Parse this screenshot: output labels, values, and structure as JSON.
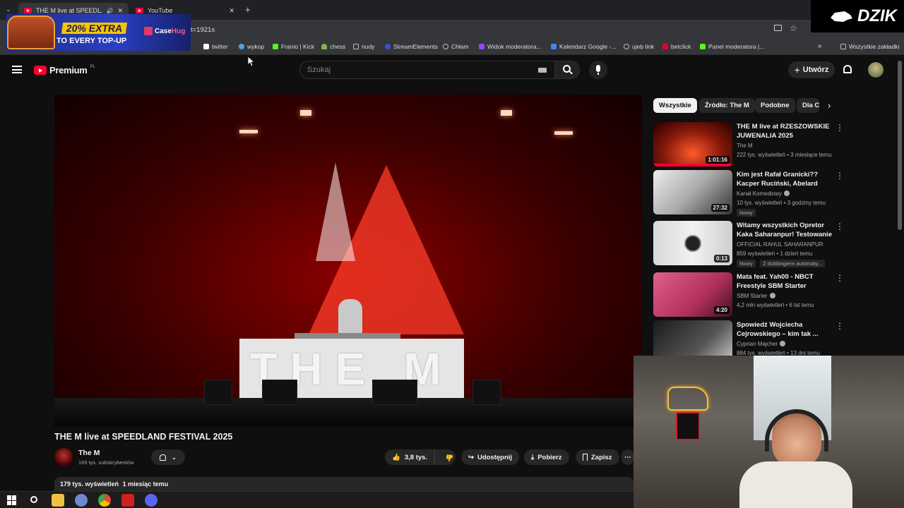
{
  "browser": {
    "tabs": [
      {
        "title": "THE M live at SPEEDLAND F"
      },
      {
        "title": "YouTube"
      }
    ],
    "address": "t=1921s",
    "bookmarks": [
      {
        "label": "twitter",
        "color": "#ffffff"
      },
      {
        "label": "wykop",
        "color": "#5aa0d8"
      },
      {
        "label": "Franio | Kick",
        "color": "#53fc18"
      },
      {
        "label": "chess",
        "color": "#81b64c"
      },
      {
        "label": "nudy",
        "color": "#999999"
      },
      {
        "label": "StreamElements",
        "color": "#3b4fd9"
      },
      {
        "label": "Chłam",
        "color": "#bbbbbb"
      },
      {
        "label": "Widok moderatora...",
        "color": "#9146ff"
      },
      {
        "label": "Kalendarz Google -...",
        "color": "#4285f4"
      },
      {
        "label": "ujeb link",
        "color": "#bbbbbb"
      },
      {
        "label": "betclick",
        "color": "#e4002b"
      },
      {
        "label": "Panel moderatora |...",
        "color": "#53fc18"
      }
    ],
    "all_bookmarks": "Wszystkie zakładki"
  },
  "overlays": {
    "promo": {
      "line1": "20% EXTRA",
      "line2": "TO EVERY TOP-UP",
      "brand_a": "Case",
      "brand_b": "Hug"
    },
    "dzik": "DZIK"
  },
  "header": {
    "logo": "Premium",
    "region": "PL",
    "search_placeholder": "Szukaj",
    "create_label": "Utwórz"
  },
  "video": {
    "stage_text": "THE M",
    "title": "THE M live at SPEEDLAND FESTIVAL 2025",
    "channel": "The M",
    "subscribers": "169 tys. subskrybentów",
    "likes": "3,8 tys.",
    "share": "Udostępnij",
    "download": "Pobierz",
    "save": "Zapisz",
    "views": "179 tys. wyświetleń",
    "date": "1 miesiąc temu"
  },
  "chips": [
    "Wszystkie",
    "Źródło: The M",
    "Podobne",
    "Dla C"
  ],
  "recommendations": [
    {
      "title": "THE M live at RZESZOWSKIE JUWENALIA 2025",
      "channel": "The M",
      "meta": "222 tys. wyświetleń • 3 miesiące temu",
      "duration": "1:01:16",
      "verified": false,
      "badges": []
    },
    {
      "title": "Kim jest Rafał Granicki?? Kacper Ruciński, Abelard Giza,...",
      "channel": "Kanał Komediowy",
      "meta": "10 tys. wyświetleń • 3 godziny temu",
      "duration": "27:32",
      "verified": true,
      "badges": [
        "Nowy"
      ]
    },
    {
      "title": "Witamy wszystkich Opretor Kaka Saharanpur! Testowanie ...",
      "channel": "OFFICIAL RAHUL SAHARANPUR",
      "meta": "859 wyświetleń • 1 dzień temu",
      "duration": "0:13",
      "verified": false,
      "badges": [
        "Nowy",
        "Z dubbingiem automaty..."
      ]
    },
    {
      "title": "Mata feat. Yah00 - NBCT Freestyle SBM Starter",
      "channel": "SBM Starter",
      "meta": "4,2 mln wyświetleń • 6 lat temu",
      "duration": "4:20",
      "verified": true,
      "badges": []
    },
    {
      "title": "Spowiedź Wojciecha Cejrowskiego – kim tak ...",
      "channel": "Cyprian Majcher",
      "meta": "884 tys. wyświetleń • 13 dni temu",
      "duration": "",
      "verified": true,
      "badges": []
    }
  ]
}
